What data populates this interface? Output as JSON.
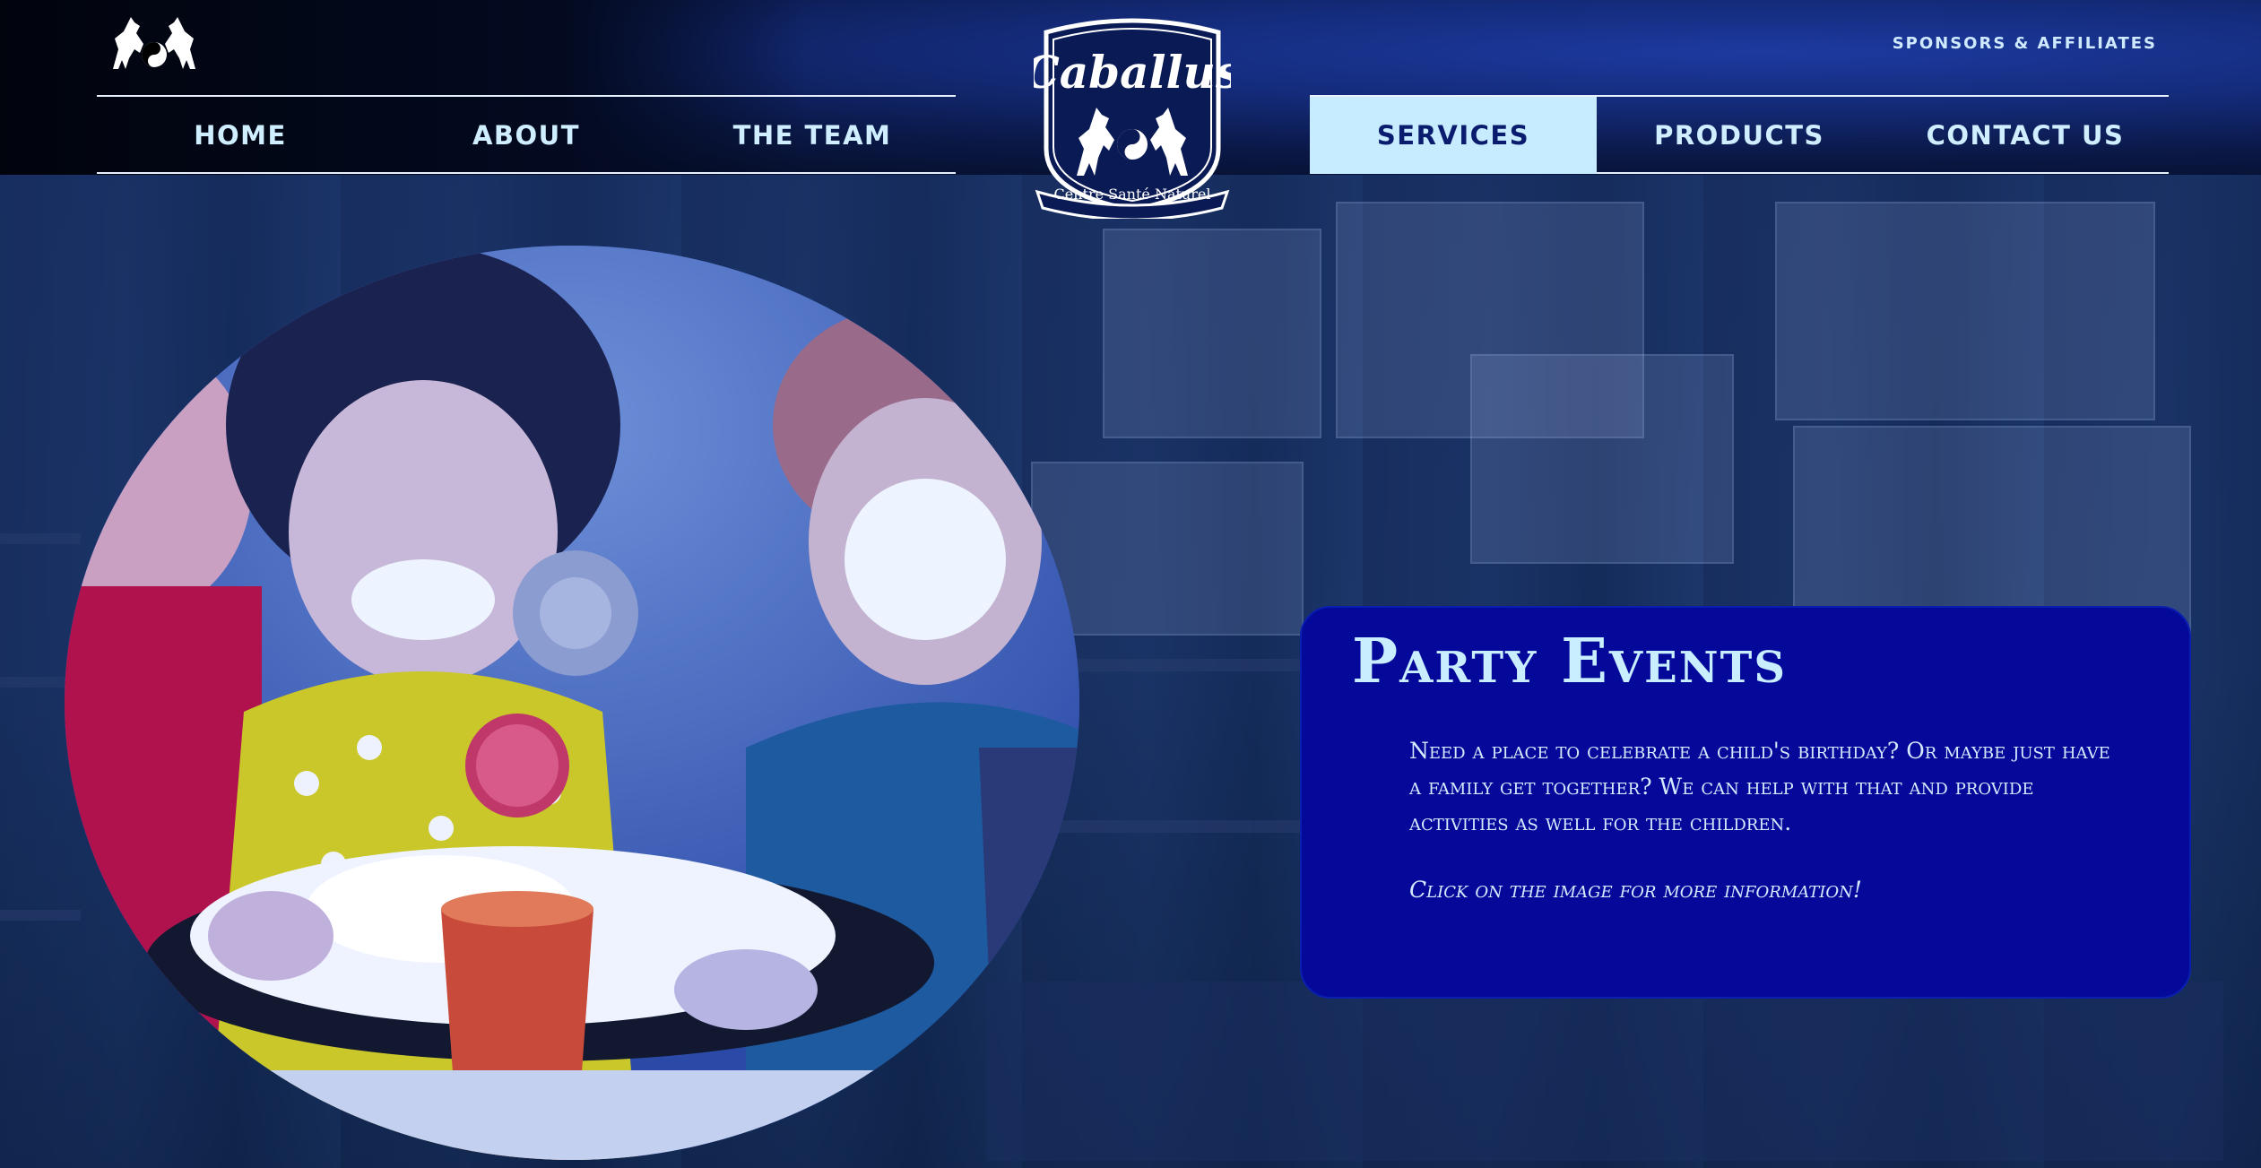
{
  "site": {
    "brand_name": "Caballus",
    "brand_tagline": "Centre Santé Naturel"
  },
  "header": {
    "sponsors_label": "SPONSORS & AFFILIATES"
  },
  "nav": {
    "items": [
      {
        "label": "HOME",
        "active": false
      },
      {
        "label": "ABOUT",
        "active": false
      },
      {
        "label": "THE TEAM",
        "active": false
      },
      {
        "label": "SERVICES",
        "active": true
      },
      {
        "label": "PRODUCTS",
        "active": false
      },
      {
        "label": "CONTACT US",
        "active": false
      }
    ]
  },
  "panel": {
    "title": "Party Events",
    "body": "Need a place to celebrate a child's birthday? Or maybe just have a family get together? We can help with that and provide activities as well for the children.",
    "cta": "Click on the image for more information!"
  },
  "colors": {
    "header_dark": "#020818",
    "nav_active_bg": "#c8ecff",
    "nav_text": "#cfeeff",
    "panel_bg": "#04099a",
    "panel_title": "#c8eeff"
  },
  "icons": {
    "logo": "horses-yin-yang-icon",
    "crest": "caballus-crest-logo"
  }
}
